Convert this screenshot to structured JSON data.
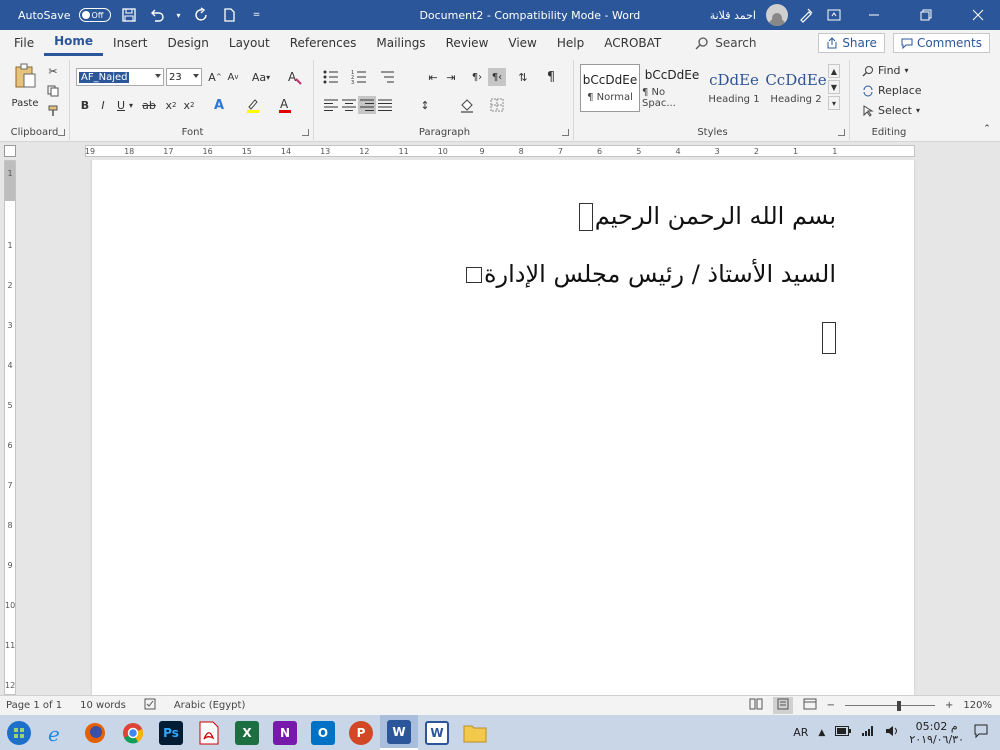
{
  "titlebar": {
    "autosave_label": "AutoSave",
    "autosave_state": "Off",
    "title": "Document2  -  Compatibility Mode  -  Word",
    "user": "احمد قلانة"
  },
  "tabs": [
    "File",
    "Home",
    "Insert",
    "Design",
    "Layout",
    "References",
    "Mailings",
    "Review",
    "View",
    "Help",
    "ACROBAT"
  ],
  "active_tab": "Home",
  "search_label": "Search",
  "share_label": "Share",
  "comments_label": "Comments",
  "ribbon": {
    "clipboard": {
      "label": "Clipboard",
      "paste": "Paste"
    },
    "font": {
      "label": "Font",
      "name": "AF_Najed",
      "size": "23",
      "case_btn": "Aa",
      "grow": "A",
      "shrink": "A",
      "bold": "B",
      "italic": "I",
      "underline": "U",
      "strike": "ab",
      "sub": "x",
      "super": "x",
      "sub_mark": "2",
      "super_mark": "2"
    },
    "paragraph": {
      "label": "Paragraph"
    },
    "styles": {
      "label": "Styles",
      "items": [
        {
          "preview": "bCcDdEe",
          "name": "¶ Normal"
        },
        {
          "preview": "bCcDdEe",
          "name": "¶ No Spac..."
        },
        {
          "preview": "cDdEe",
          "name": "Heading 1"
        },
        {
          "preview": "CcDdEe",
          "name": "Heading 2"
        }
      ]
    },
    "editing": {
      "label": "Editing",
      "find": "Find",
      "replace": "Replace",
      "select": "Select"
    }
  },
  "ruler": {
    "h_numbers": [
      "19",
      "18",
      "17",
      "16",
      "15",
      "14",
      "13",
      "12",
      "11",
      "10",
      "9",
      "8",
      "7",
      "6",
      "5",
      "4",
      "3",
      "2",
      "1",
      "1"
    ],
    "v_numbers": [
      "1",
      "1",
      "2",
      "3",
      "4",
      "5",
      "6",
      "7",
      "8",
      "9",
      "10",
      "11",
      "12"
    ]
  },
  "document": {
    "line1": "بسم الله الرحمن الرحيم",
    "line2": "السيد الأستاذ / رئيس مجلس الإدارة"
  },
  "statusbar": {
    "page": "Page 1 of 1",
    "words": "10 words",
    "language": "Arabic (Egypt)",
    "zoom": "120%",
    "zoom_fraction": 0.6
  },
  "taskbar": {
    "lang": "AR",
    "time": "05:02 م",
    "date": "٢٠١٩/٠٦/٣٠"
  },
  "colors": {
    "word_blue": "#2b579a",
    "highlight_yellow": "#ffff00",
    "font_red": "#e00000"
  }
}
